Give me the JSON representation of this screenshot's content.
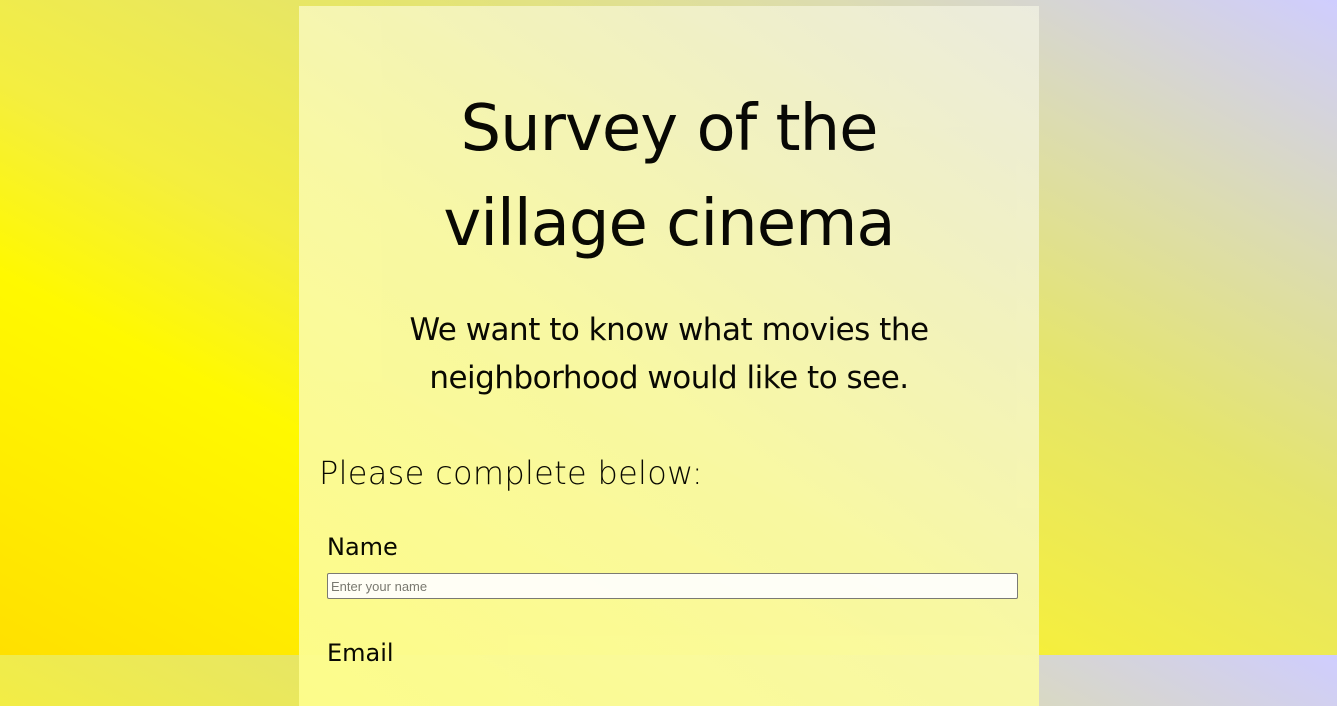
{
  "page": {
    "title_line_1": "Survey of the",
    "title_line_2": "village cinema",
    "description_line_1": "We want to know what movies the",
    "description_line_2": "neighborhood would like to see."
  },
  "form": {
    "section_heading": "Please complete below:",
    "name": {
      "label": "Name",
      "value": "",
      "placeholder": "Enter your name"
    },
    "email": {
      "label": "Email"
    }
  },
  "colors": {
    "background_left": "#ffe000",
    "background_right": "#cfcdff",
    "card_background": "#f9f9a6",
    "text": "#000000"
  }
}
